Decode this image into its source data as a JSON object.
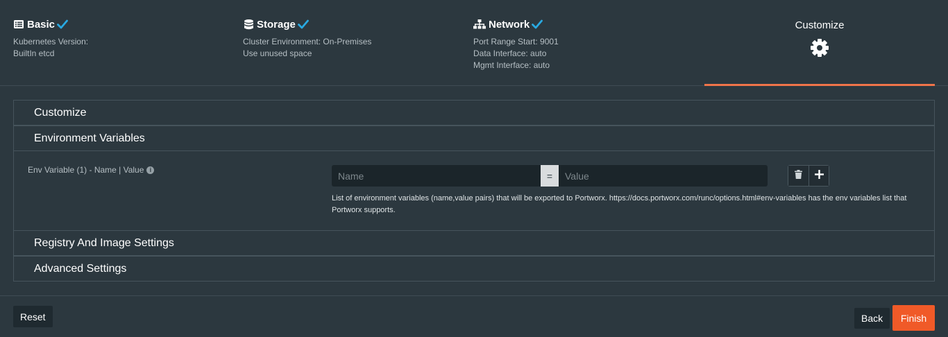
{
  "steps": [
    {
      "title": "Basic",
      "icon": "list-icon",
      "completed": true,
      "lines": [
        "Kubernetes Version:",
        "BuiltIn etcd"
      ]
    },
    {
      "title": "Storage",
      "icon": "database-icon",
      "completed": true,
      "lines": [
        "Cluster Environment: On-Premises",
        "Use unused space"
      ]
    },
    {
      "title": "Network",
      "icon": "sitemap-icon",
      "completed": true,
      "lines": [
        "Port Range Start: 9001",
        "Data Interface: auto",
        "Mgmt Interface: auto"
      ]
    }
  ],
  "active_step": {
    "title": "Customize",
    "icon": "gear-icon"
  },
  "colors": {
    "accent": "#f05a28",
    "check": "#29a9e1",
    "active_underline": "#f0744a"
  },
  "panels": {
    "customize": "Customize",
    "env": "Environment Variables",
    "registry": "Registry And Image Settings",
    "advanced": "Advanced Settings"
  },
  "env": {
    "label": "Env Variable (1) - Name | Value",
    "name_placeholder": "Name",
    "equals": "=",
    "value_placeholder": "Value",
    "help": "List of environment variables (name,value pairs) that will be exported to Portworx. https://docs.portworx.com/runc/options.html#env-variables has the env variables list that Portworx supports."
  },
  "footer": {
    "reset": "Reset",
    "back": "Back",
    "finish": "Finish"
  }
}
